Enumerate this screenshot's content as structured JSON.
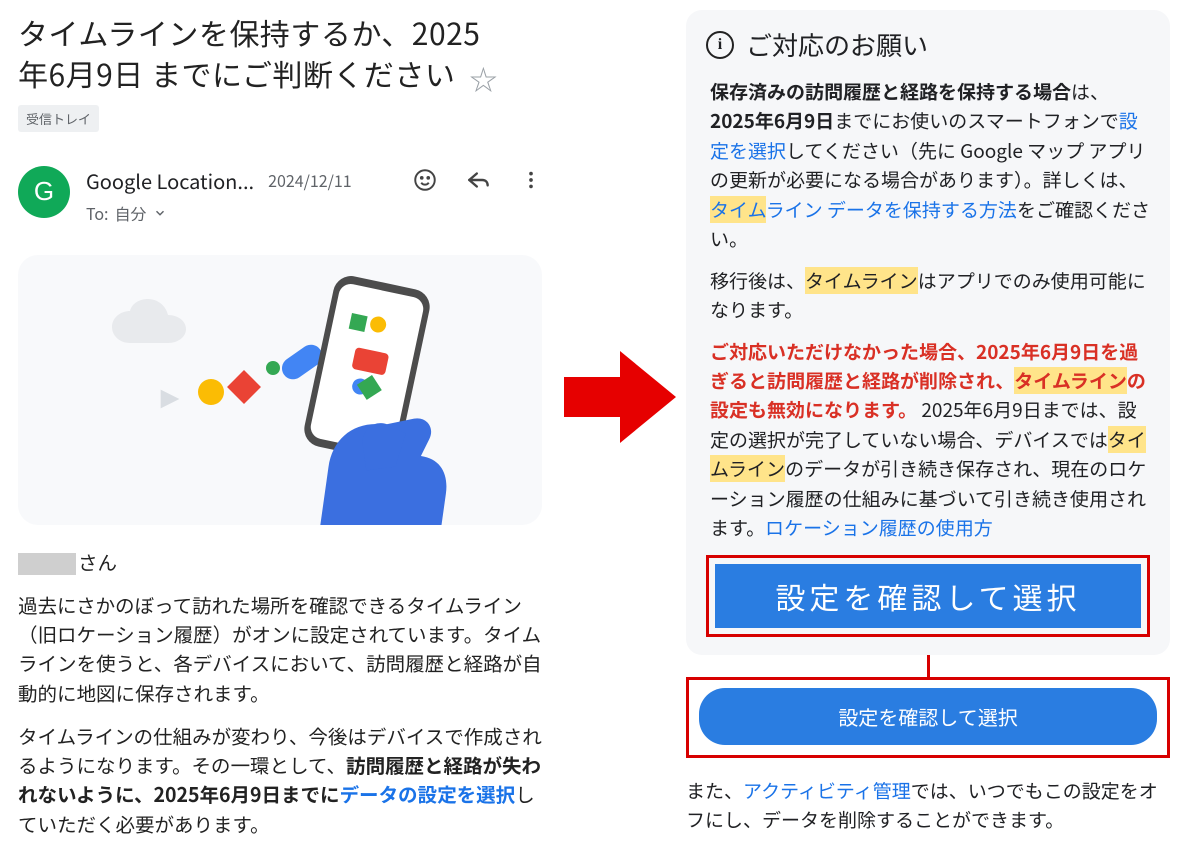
{
  "email": {
    "title_line1": "タイムラインを保持するか、2025",
    "title_line2": "年6月9日 までにご判断ください",
    "inbox_label": "受信トレイ",
    "avatar_initial": "G",
    "sender": "Google Location...",
    "date": "2024/12/11",
    "to_label": "To:",
    "to_value": "自分",
    "body": {
      "san": "さん",
      "p1": "過去にさかのぼって訪れた場所を確認できるタイムライン（旧ロケーション履歴）がオンに設定されています。タイムラインを使うと、各デバイスにおいて、訪問履歴と経路が自動的に地図に保存されます。",
      "p2_a": "タイムラインの仕組みが変わり、今後はデバイスで作成されるようになります。その一環として、",
      "p2_bold": "訪問履歴と経路が失われないように、2025年6月9日までに",
      "p2_link": "データの設定を選択",
      "p2_b": "していただく必要があります。"
    }
  },
  "panel": {
    "heading": "ご対応のお願い",
    "p1_bold": "保存済みの訪問履歴と経路を保持する場合",
    "p1_a": "は、",
    "p1_date": "2025年6月9日",
    "p1_b": "までにお使いのスマートフォンで",
    "p1_link1": "設定を選択",
    "p1_c": "してください（先に Google マップ アプリの更新が必要になる場合があります）。詳しくは、",
    "p1_hl_link_a": "タイム",
    "p1_hl_link_b": "ライン データを保持する方法",
    "p1_d": "をご確認ください。",
    "p2_a": "移行後は、",
    "p2_hl": "タイムライン",
    "p2_b": "はアプリでのみ使用可能になります。",
    "p3_red_a": "ご対応いただけなかった場合、2025年6月9日を過ぎると訪問履歴と経路が削除され、",
    "p3_hl": "タイムライン",
    "p3_red_b": "の設定も無効になります。",
    "p3_c": "2025年6月9日までは、設定の選択が完了していない場合、デバイスでは",
    "p3_hl2": "タイムライン",
    "p3_d": "のデータが引き続き保存され、現在のロケーション履歴の仕組みに基づいて引き続き使用されます。",
    "p3_link": "ロケーション履歴の使用方",
    "cta_band": "設定を確認して選択",
    "cta_btn": "設定を確認して選択",
    "footer_a": "また、",
    "footer_link": "アクティビティ管理",
    "footer_b": "では、いつでもこの設定をオフにし、データを削除することができます。"
  }
}
